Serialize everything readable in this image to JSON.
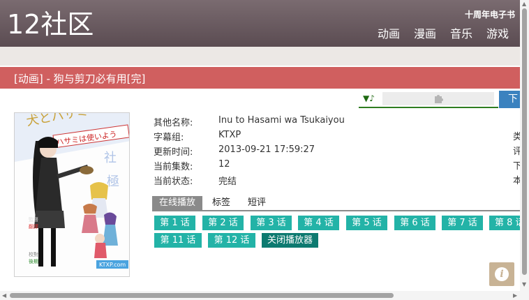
{
  "header": {
    "logo_num": "12",
    "logo_text": "社区",
    "ebook": "十周年电子书",
    "nav": [
      "动画",
      "漫画",
      "音乐",
      "游戏"
    ]
  },
  "title": "[动画] - 狗与剪刀必有用[完]",
  "download_label": "下",
  "cover": {
    "banner_text": "ハサミは使いよう",
    "watermark": "KTXP.com"
  },
  "info": {
    "rows": [
      {
        "key": "其他名称:",
        "value": "Inu to Hasami wa Tsukaiyou"
      },
      {
        "key": "字幕组:",
        "value": "KTXP"
      },
      {
        "key": "更新时间:",
        "value": "2013-09-21 17:59:27"
      },
      {
        "key": "当前集数:",
        "value": "12"
      },
      {
        "key": "当前状态:",
        "value": "完结"
      }
    ],
    "right_column": [
      "类",
      "评",
      "下",
      "本"
    ]
  },
  "tabs": [
    "在线播放",
    "标签",
    "短评"
  ],
  "episodes": [
    "第 1 话",
    "第 2 话",
    "第 3 话",
    "第 4 话",
    "第 5 话",
    "第 6 话",
    "第 7 话",
    "第 8 话",
    "第 11 话",
    "第 12 话"
  ],
  "close_player": "关闭播放器",
  "colors": {
    "header": "#6b5c62",
    "title_bar": "#d05f5f",
    "episode_button": "#23b3a7",
    "close_button": "#0d7a70",
    "download_button": "#3b82bf"
  },
  "icons": [
    "music-note-icon",
    "puzzle-icon",
    "info-icon"
  ]
}
